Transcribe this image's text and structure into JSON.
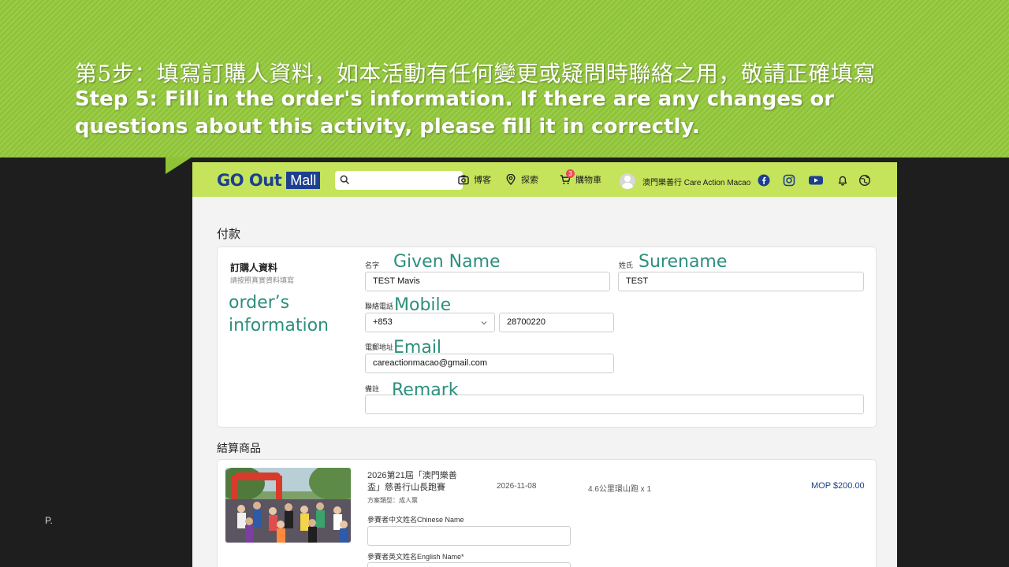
{
  "slide": {
    "title_zh": "第5步：填寫訂購人資料，如本活動有任何變更或疑問時聯絡之用，敬請正確填寫",
    "title_en": "Step 5: Fill in the order's information. If there are any changes or questions about this activity, please fill it in correctly.",
    "page_marker": "P."
  },
  "header": {
    "logo_text": "GO Out",
    "logo_badge": "Mall",
    "search_placeholder": "",
    "nav": {
      "blog": "博客",
      "explore": "探索",
      "cart": "購物車",
      "cart_count": "3"
    },
    "user_name": "澳門樂善行 Care Action Macao",
    "icons": [
      "camera-icon",
      "location-pin-icon",
      "cart-icon",
      "facebook-icon",
      "instagram-icon",
      "youtube-icon",
      "bell-icon",
      "globe-icon"
    ],
    "brand_color": "#1d3f8f",
    "bar_color": "#c5e45c"
  },
  "payment": {
    "title": "付款",
    "orderer_title": "訂購人資料",
    "orderer_hint": "請按照真實資料填寫",
    "fields": {
      "given_label": "名字",
      "given_value": "TEST Mavis",
      "surname_label": "姓氏",
      "surname_value": "TEST",
      "phone_label": "聯絡電話",
      "phone_code": "+853",
      "phone_value": "28700220",
      "email_label": "電郵地址",
      "email_value": "careactionmacao@gmail.com",
      "remark_label": "備註",
      "remark_value": ""
    }
  },
  "annotations": {
    "given": "Given Name",
    "surname": "Surename",
    "order_info": "order’s\ninformation",
    "mobile": "Mobile",
    "email": "Email",
    "remark": "Remark",
    "color": "#2c8f7d"
  },
  "checkout": {
    "title": "結算商品",
    "item": {
      "name": "2026第21屆「澳門樂善盃」慈善行山長跑賽",
      "name_line1": "2026第21屆「澳門樂善",
      "name_line2": "盃」慈善行山長跑賽",
      "plan": "方案類型：成人票",
      "date": "2026-11-08",
      "option": "4.6公里環山跑 x 1",
      "price": "MOP $200.00",
      "chinese_name_label": "參賽者中文姓名Chinese Name",
      "chinese_name_value": "",
      "english_name_label": "參賽者英文姓名English Name*",
      "english_name_value": ""
    }
  }
}
